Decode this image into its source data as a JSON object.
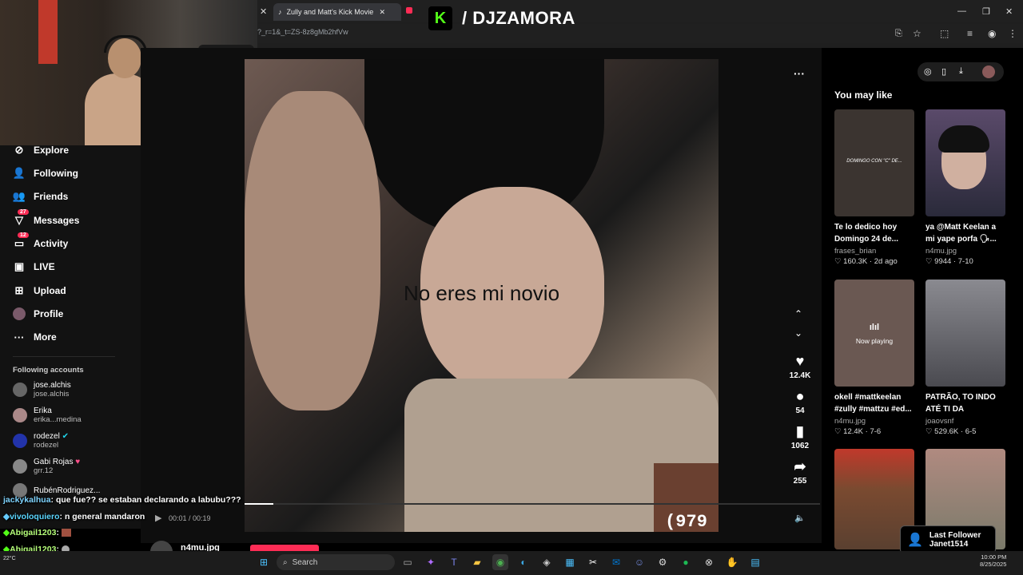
{
  "browser": {
    "tab_title": "Zully and Matt's Kick Movie Ed",
    "url": "?_r=1&_t=ZS-8z8gMb2hfVw",
    "window_controls": [
      "—",
      "❐",
      "✕"
    ]
  },
  "overlay": {
    "brand": "/ DJZAMORA"
  },
  "sidebar": {
    "nav": [
      {
        "label": "Explore",
        "icon": "compass-icon"
      },
      {
        "label": "Following",
        "icon": "following-icon"
      },
      {
        "label": "Friends",
        "icon": "friends-icon"
      },
      {
        "label": "Messages",
        "icon": "messages-icon",
        "badge": "27"
      },
      {
        "label": "Activity",
        "icon": "activity-icon",
        "badge": "12"
      },
      {
        "label": "LIVE",
        "icon": "live-icon"
      },
      {
        "label": "Upload",
        "icon": "upload-icon"
      },
      {
        "label": "Profile",
        "icon": "profile-icon"
      },
      {
        "label": "More",
        "icon": "more-icon"
      }
    ],
    "following_title": "Following accounts",
    "accounts": [
      {
        "name": "jose.alchis",
        "handle": "jose.alchis"
      },
      {
        "name": "Erika",
        "handle": "erika...medina"
      },
      {
        "name": "rodezel",
        "handle": "rodezel"
      },
      {
        "name": "Gabi Rojas",
        "handle": "grr.12"
      },
      {
        "name": "RubénRodriguez...",
        "handle": ""
      }
    ]
  },
  "video": {
    "caption": "No eres mi novio",
    "time": "00:01 / 00:19",
    "author": "n4mu.jpg",
    "likes": "12.4K",
    "comments": "54",
    "saves": "1062",
    "shares": "255"
  },
  "right": {
    "heading": "You may like",
    "cards": [
      {
        "title": "Te lo dedico hoy Domingo 24 de...",
        "user": "frases_brian",
        "likes": "160.3K",
        "date": "2d ago",
        "overlay": "DOMINGO CON \"C\" DE...",
        "bg": "#3b3430"
      },
      {
        "title": "ya @Matt Keelan a mi yape porfa 🗣...",
        "user": "n4mu.jpg",
        "likes": "9944",
        "date": "7-10",
        "overlay": "",
        "bg": "#5a4a6a"
      },
      {
        "title": "okell #mattkeelan #zully #mattzu #ed...",
        "user": "n4mu.jpg",
        "likes": "12.4K",
        "date": "7-6",
        "overlay": "Now playing",
        "bg": "#6a5852"
      },
      {
        "title": "PATRÃO, TO INDO ATÉ TI DA MELHOR...",
        "user": "joaovsnf",
        "likes": "529.6K",
        "date": "6-5",
        "overlay": "",
        "bg": "#6a6a70"
      },
      {
        "title": "",
        "user": "",
        "likes": "",
        "date": "",
        "overlay": "",
        "bg": "#7a4a30"
      },
      {
        "title": "",
        "user": "",
        "likes": "",
        "date": "",
        "overlay": "",
        "bg": "#8a8a7a"
      }
    ]
  },
  "chat": [
    {
      "user": "jackykalhua",
      "text": "que fue?? se estaban declarando a labubu???"
    },
    {
      "user": "vivoloquiero",
      "text": "n general mandaron"
    },
    {
      "user": "Abigail1203",
      "text": ""
    },
    {
      "user": "Abigail1203",
      "text": ""
    }
  ],
  "follower": {
    "label": "Last Follower",
    "name": "Janet1514"
  },
  "taskbar": {
    "search": "Search",
    "time": "10:00 PM",
    "date": "8/25/2025",
    "weather": "22°C"
  }
}
